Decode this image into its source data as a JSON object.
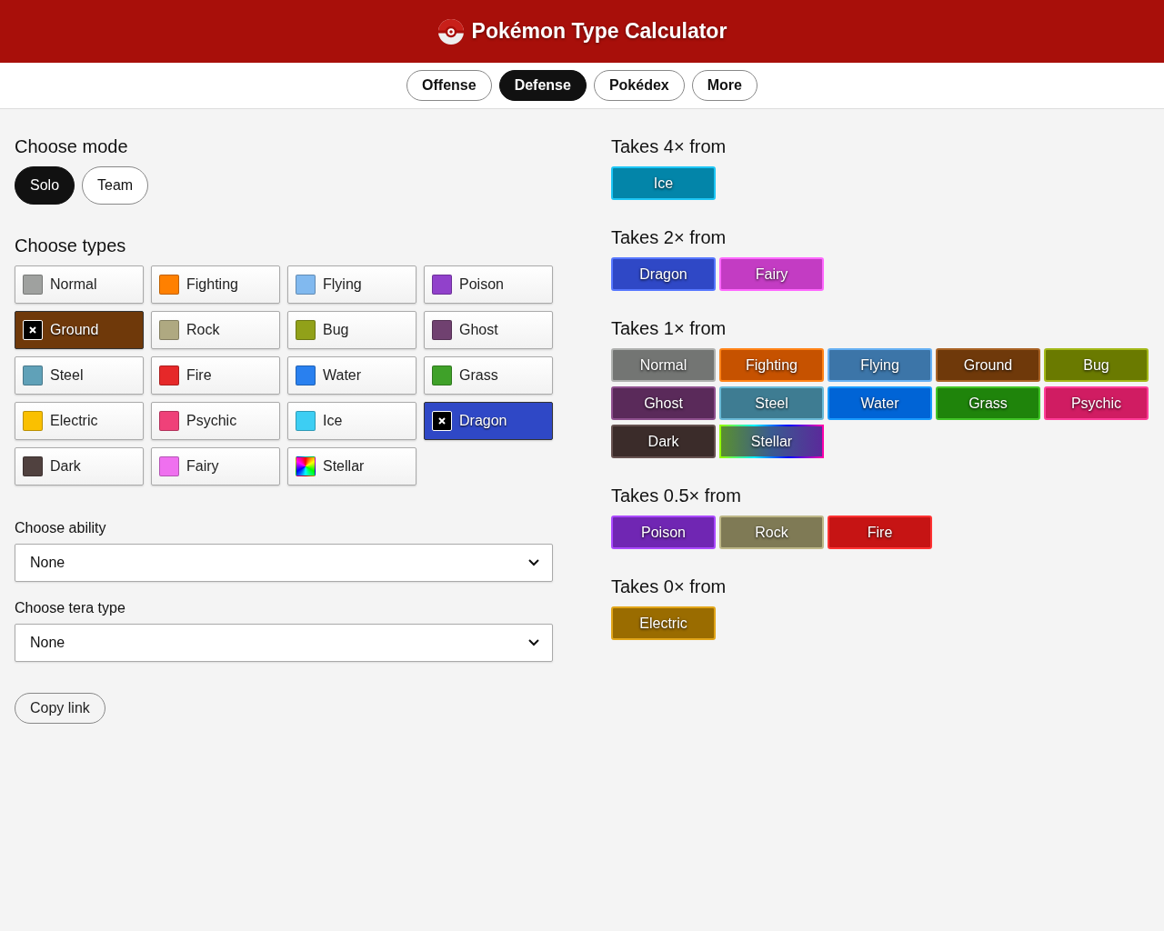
{
  "header": {
    "title": "Pokémon Type Calculator"
  },
  "nav": [
    {
      "label": "Offense",
      "selected": false
    },
    {
      "label": "Defense",
      "selected": true
    },
    {
      "label": "Pokédex",
      "selected": false
    },
    {
      "label": "More",
      "selected": false
    }
  ],
  "mode": {
    "heading": "Choose mode",
    "options": [
      {
        "label": "Solo",
        "selected": true
      },
      {
        "label": "Team",
        "selected": false
      }
    ]
  },
  "types": {
    "heading": "Choose types",
    "items": [
      {
        "label": "Normal",
        "color": "#9fa19f",
        "selected": false
      },
      {
        "label": "Fighting",
        "color": "#ff8000",
        "selected": false
      },
      {
        "label": "Flying",
        "color": "#81b9ef",
        "selected": false
      },
      {
        "label": "Poison",
        "color": "#9141cb",
        "selected": false
      },
      {
        "label": "Ground",
        "color": "#6f390a",
        "selected": true
      },
      {
        "label": "Rock",
        "color": "#afa981",
        "selected": false
      },
      {
        "label": "Bug",
        "color": "#91a119",
        "selected": false
      },
      {
        "label": "Ghost",
        "color": "#704170",
        "selected": false
      },
      {
        "label": "Steel",
        "color": "#60a1b8",
        "selected": false
      },
      {
        "label": "Fire",
        "color": "#e62829",
        "selected": false
      },
      {
        "label": "Water",
        "color": "#2980ef",
        "selected": false
      },
      {
        "label": "Grass",
        "color": "#3fa129",
        "selected": false
      },
      {
        "label": "Electric",
        "color": "#fac000",
        "selected": false
      },
      {
        "label": "Psychic",
        "color": "#ef4179",
        "selected": false
      },
      {
        "label": "Ice",
        "color": "#3dcef3",
        "selected": false
      },
      {
        "label": "Dragon",
        "color": "#2f48c6",
        "selected": true
      },
      {
        "label": "Dark",
        "color": "#50413f",
        "selected": false
      },
      {
        "label": "Fairy",
        "color": "#ef70ef",
        "selected": false
      },
      {
        "label": "Stellar",
        "kind": "rainbow",
        "selected": false
      }
    ]
  },
  "ability": {
    "label": "Choose ability",
    "value": "None"
  },
  "tera": {
    "label": "Choose tera type",
    "value": "None"
  },
  "copy_link": "Copy link",
  "results": [
    {
      "heading": "Takes 4× from",
      "types": [
        {
          "label": "Ice",
          "color": "#0385a9"
        }
      ]
    },
    {
      "heading": "Takes 2× from",
      "types": [
        {
          "label": "Dragon",
          "color": "#2f48c6"
        },
        {
          "label": "Fairy",
          "color": "#c33cc3"
        }
      ]
    },
    {
      "heading": "Takes 1× from",
      "types": [
        {
          "label": "Normal",
          "color": "#737573"
        },
        {
          "label": "Fighting",
          "color": "#c65200"
        },
        {
          "label": "Flying",
          "color": "#3c75a8"
        },
        {
          "label": "Ground",
          "color": "#6f390a"
        },
        {
          "label": "Bug",
          "color": "#6a7a00"
        },
        {
          "label": "Ghost",
          "color": "#5a2a5a"
        },
        {
          "label": "Steel",
          "color": "#3e7c92"
        },
        {
          "label": "Water",
          "color": "#0064d6"
        },
        {
          "label": "Grass",
          "color": "#1f840b"
        },
        {
          "label": "Psychic",
          "color": "#d01c62"
        },
        {
          "label": "Dark",
          "color": "#3b2c2a"
        },
        {
          "label": "Stellar",
          "kind": "rainbow"
        }
      ]
    },
    {
      "heading": "Takes 0.5× from",
      "types": [
        {
          "label": "Poison",
          "color": "#7026b3"
        },
        {
          "label": "Rock",
          "color": "#7f7a55"
        },
        {
          "label": "Fire",
          "color": "#c61414"
        }
      ]
    },
    {
      "heading": "Takes 0× from",
      "types": [
        {
          "label": "Electric",
          "color": "#9a6c00"
        }
      ]
    }
  ]
}
